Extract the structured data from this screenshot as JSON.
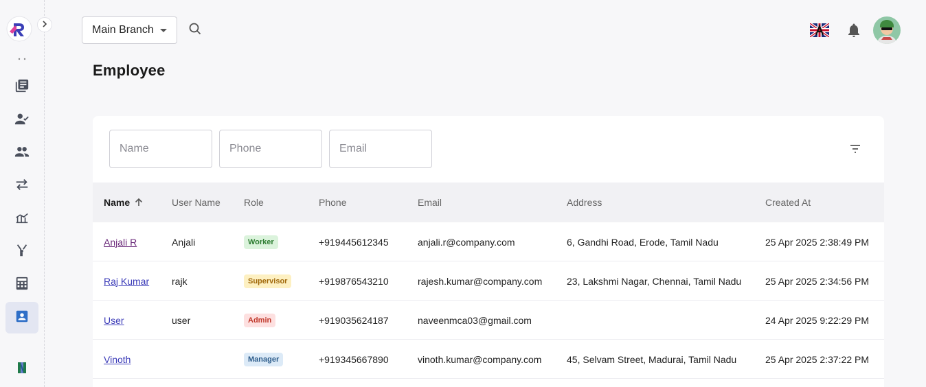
{
  "topbar": {
    "branch": "Main Branch"
  },
  "page": {
    "title": "Employee"
  },
  "filters": {
    "name_placeholder": "Name",
    "phone_placeholder": "Phone",
    "email_placeholder": "Email"
  },
  "table": {
    "headers": {
      "name": "Name",
      "username": "User Name",
      "role": "Role",
      "phone": "Phone",
      "email": "Email",
      "address": "Address",
      "created": "Created At"
    },
    "rows": [
      {
        "name": "Anjali R",
        "username": "Anjali",
        "role": "Worker",
        "phone": "+919445612345",
        "email": "anjali.r@company.com",
        "address": "6, Gandhi Road, Erode, Tamil Nadu",
        "created": "25 Apr 2025 2:38:49 PM"
      },
      {
        "name": "Raj Kumar",
        "username": "rajk",
        "role": "Supervisor",
        "phone": "+919876543210",
        "email": "rajesh.kumar@company.com",
        "address": "23, Lakshmi Nagar, Chennai, Tamil Nadu",
        "created": "25 Apr 2025 2:34:56 PM"
      },
      {
        "name": "User",
        "username": "user",
        "role": "Admin",
        "phone": "+919035624187",
        "email": "naveenmca03@gmail.com",
        "address": "",
        "created": "24 Apr 2025 9:22:29 PM"
      },
      {
        "name": "Vinoth",
        "username": "",
        "role": "Manager",
        "phone": "+919345667890",
        "email": "vinoth.kumar@company.com",
        "address": "45, Selvam Street, Madurai, Tamil Nadu",
        "created": "25 Apr 2025 2:37:22 PM"
      }
    ]
  },
  "colors": {
    "accent": "#3b3bb8",
    "worker": "#2e7d32",
    "supervisor": "#a0680a",
    "admin": "#c0392b",
    "manager": "#2b5b8a"
  }
}
